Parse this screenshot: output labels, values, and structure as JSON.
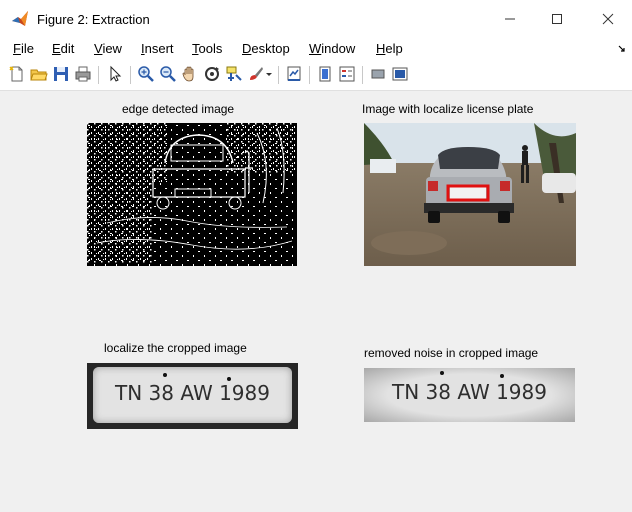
{
  "window": {
    "title": "Figure 2: Extraction",
    "controls": [
      "minimize",
      "maximize",
      "close"
    ]
  },
  "menu": [
    {
      "label": "File",
      "mnemonic": "F",
      "rest": "ile"
    },
    {
      "label": "Edit",
      "mnemonic": "E",
      "rest": "dit"
    },
    {
      "label": "View",
      "mnemonic": "V",
      "rest": "iew"
    },
    {
      "label": "Insert",
      "mnemonic": "I",
      "rest": "nsert"
    },
    {
      "label": "Tools",
      "mnemonic": "T",
      "rest": "ools"
    },
    {
      "label": "Desktop",
      "mnemonic": "D",
      "rest": "esktop"
    },
    {
      "label": "Window",
      "mnemonic": "W",
      "rest": "indow"
    },
    {
      "label": "Help",
      "mnemonic": "H",
      "rest": "elp"
    }
  ],
  "toolbar": [
    "new-figure-icon",
    "open-file-icon",
    "save-icon",
    "print-icon",
    "pointer-icon",
    "zoom-in-icon",
    "zoom-out-icon",
    "pan-hand-icon",
    "rotate-3d-icon",
    "data-cursor-icon",
    "brush-icon",
    "brush-dropdown-icon",
    "link-plot-icon",
    "colorbar-icon",
    "legend-icon",
    "hide-plot-tools-icon",
    "show-plot-tools-icon"
  ],
  "panels": {
    "top_left": {
      "caption": "edge detected image"
    },
    "top_right": {
      "caption": "Image with localize license plate"
    },
    "bottom_left": {
      "caption": "localize the cropped image",
      "plate_text": "TN 38 AW 1989"
    },
    "bottom_right": {
      "caption": "removed noise in cropped image",
      "plate_text": "TN 38 AW 1989"
    }
  },
  "colors": {
    "plate_highlight": "#e01010",
    "figure_bg": "#f0f0f0"
  }
}
